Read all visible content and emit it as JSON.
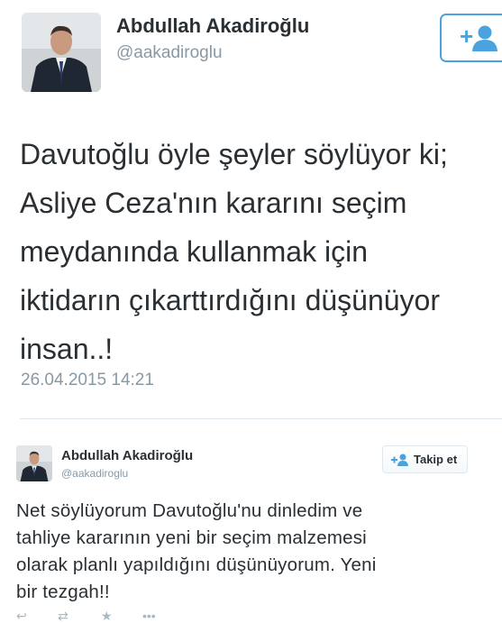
{
  "tweet_main": {
    "author_name": "Abdullah Akadiroğlu",
    "handle": "@aakadiroglu",
    "lines": [
      "Davutoğlu öyle şeyler söylüyor ki;",
      "Asliye Ceza'nın kararını seçim",
      "meydanında kullanmak için",
      "iktidarın çıkarttırdığını düşünüyor",
      "insan..!"
    ],
    "date": "26.04.2015 14:21",
    "follow_icon": "follow-user-icon"
  },
  "tweet_embedded": {
    "author_name": "Abdullah Akadiroğlu",
    "handle": "@aakadiroglu",
    "follow_label": "Takip et",
    "lines": [
      "Net söylüyorum Davutoğlu'nu dinledim ve",
      "tahliye kararının yeni bir seçim malzemesi",
      "olarak planlı yapıldığını düşünüyorum. Yeni",
      "bir tezgah!!"
    ],
    "action_icons": [
      "reply-icon",
      "retweet-icon",
      "favorite-icon",
      "more-icon"
    ]
  },
  "colors": {
    "text": "#292f33",
    "muted": "#8899a6",
    "accent": "#4aa3df",
    "divider": "#e1e8ed"
  }
}
